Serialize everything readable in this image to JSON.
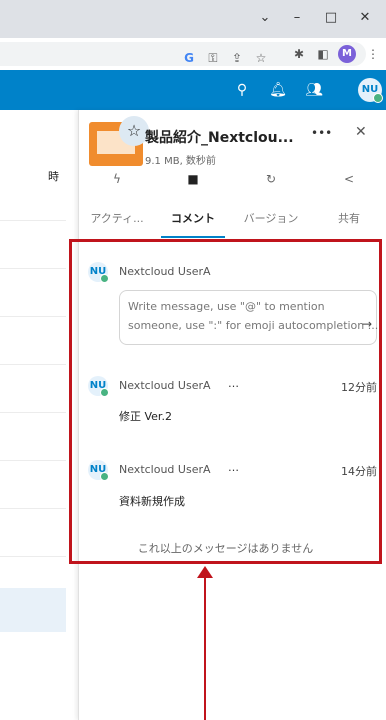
{
  "browser": {
    "window_controls": {
      "dropdown": "⌄",
      "minimize": "–",
      "maximize": "□",
      "close": "✕"
    },
    "profile_initial": "M"
  },
  "header": {
    "user_initials": "NU"
  },
  "left_list": {
    "partial_text": "時"
  },
  "file": {
    "name": "製品紹介_Nextclou...",
    "meta": "9.1 MB, 数秒前"
  },
  "tabs": [
    {
      "label": "アクティ...",
      "icon": "activity-icon"
    },
    {
      "label": "コメント",
      "icon": "comment-icon",
      "active": true
    },
    {
      "label": "バージョン",
      "icon": "history-icon"
    },
    {
      "label": "共有",
      "icon": "share-icon"
    }
  ],
  "composer": {
    "user": "Nextcloud UserA",
    "initials": "NU",
    "placeholder": "Write message, use \"@\" to mention someone, use \":\" for emoji autocompletion ..."
  },
  "comments": [
    {
      "user": "Nextcloud UserA",
      "initials": "NU",
      "more": "…",
      "time": "12分前",
      "text": "修正 Ver.2"
    },
    {
      "user": "Nextcloud UserA",
      "initials": "NU",
      "more": "…",
      "time": "14分前",
      "text": "資料新規作成"
    }
  ],
  "no_more_text": "これ以上のメッセージはありません",
  "colors": {
    "accent": "#0082c9",
    "highlight": "#c0141c",
    "online": "#49b382",
    "file_icon": "#f08c2e"
  }
}
